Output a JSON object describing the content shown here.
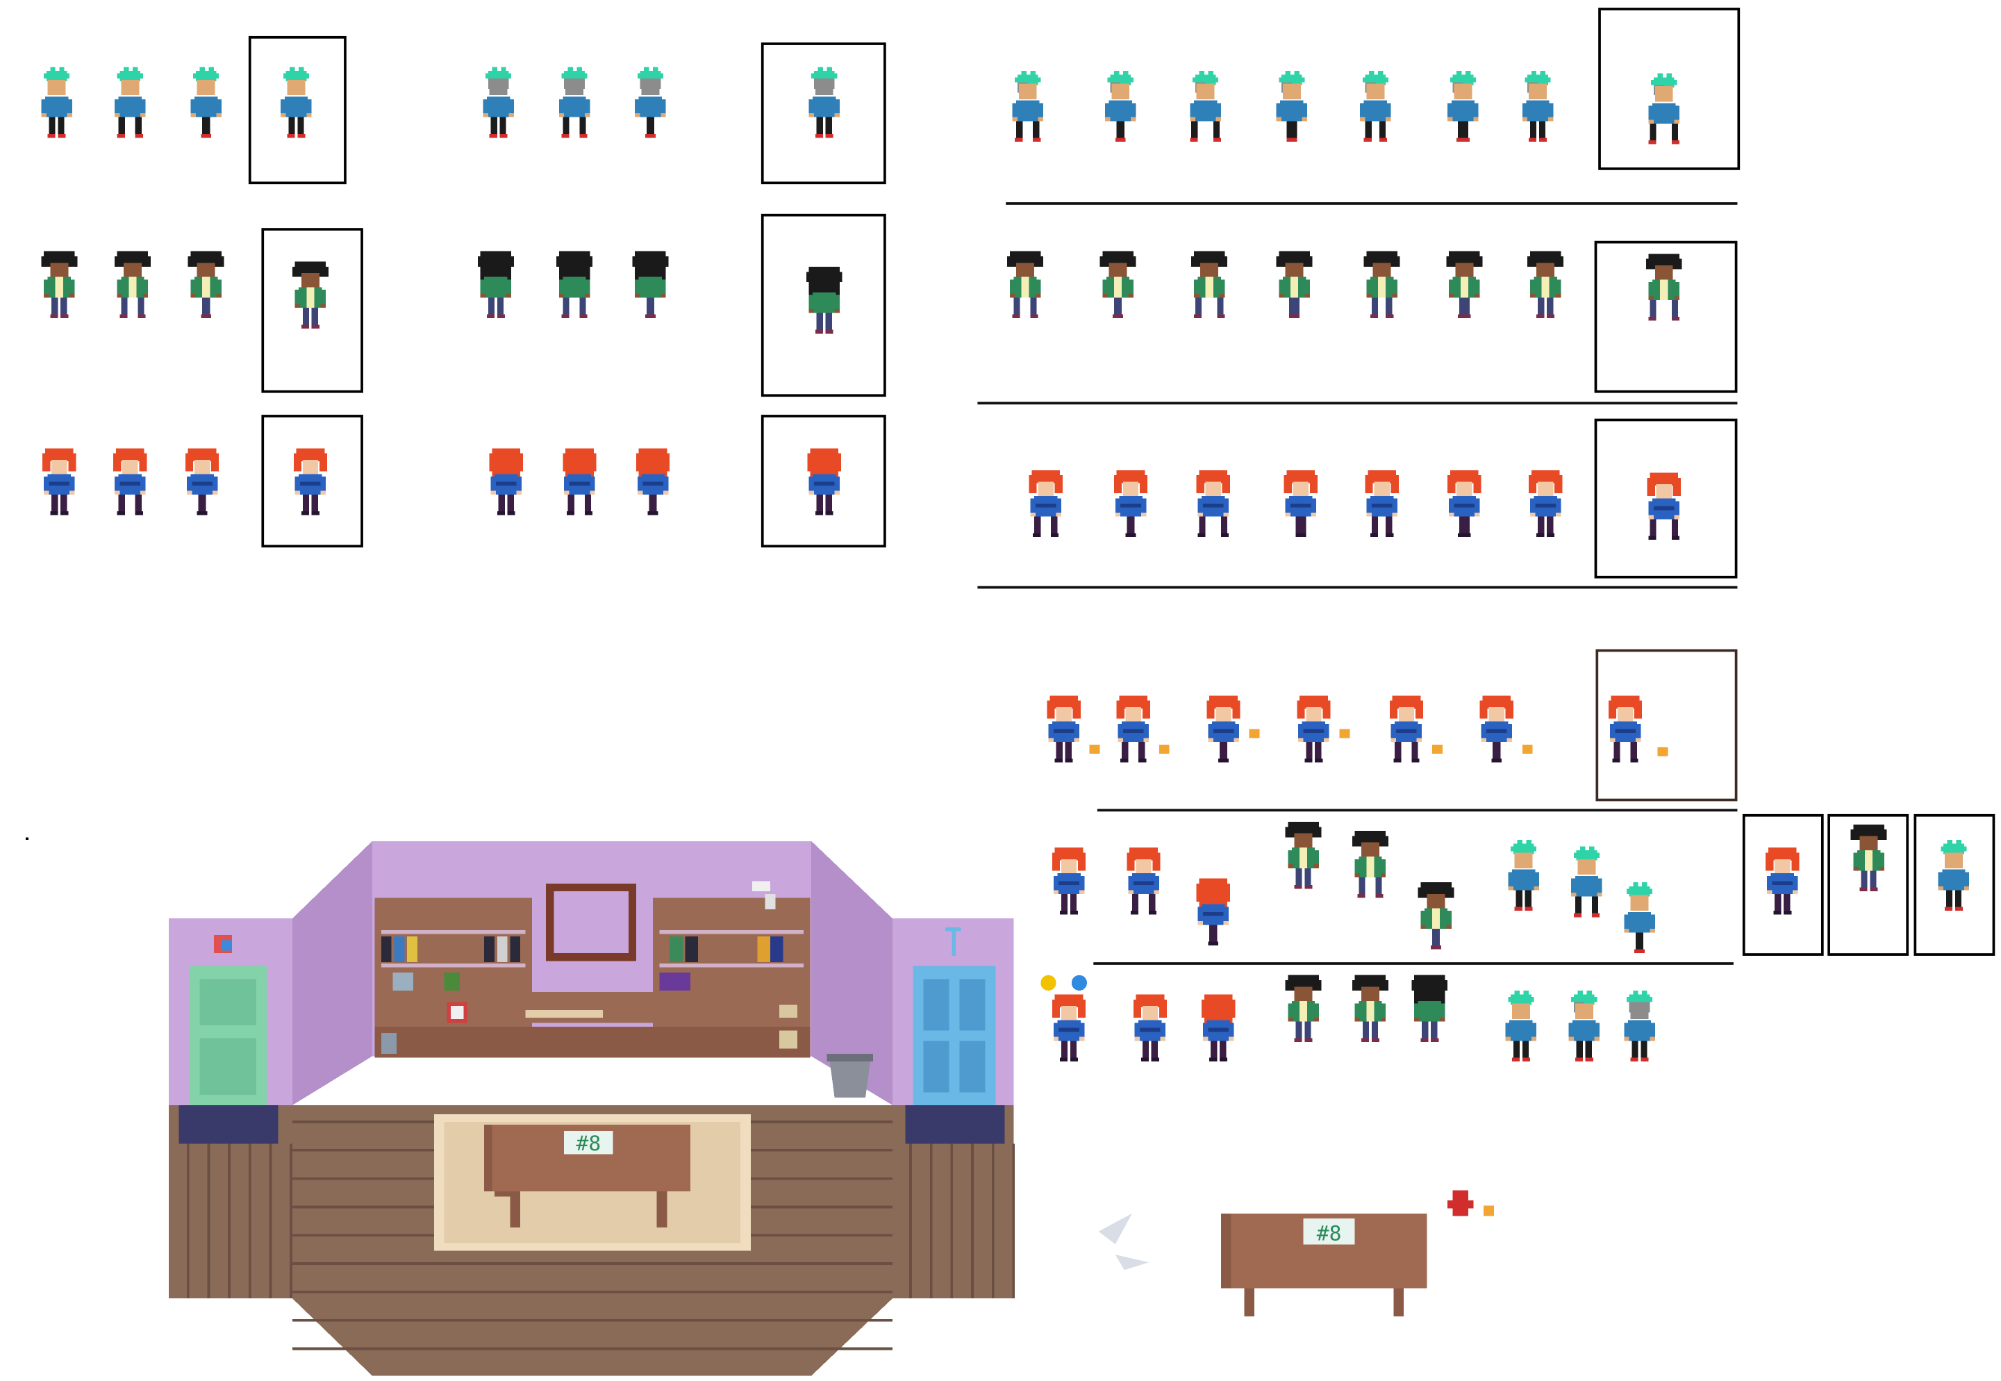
{
  "sheet": {
    "characters": [
      {
        "id": "teal-boy",
        "hair": "#2fd3a8",
        "hair_side": "#8c8c8c",
        "skin": "#e0a872",
        "shirt": "#2f7fb8",
        "sleeve": "#e56a3a",
        "pants": "#1c1c1c",
        "shoes": "#d12d2d"
      },
      {
        "id": "curly-girl",
        "hair": "#1a1a1a",
        "hair_side": "#1a1a1a",
        "skin": "#8a5436",
        "shirt": "#2f8a5a",
        "undershirt": "#f3efb6",
        "pants": "#3d4577",
        "shoes": "#7a2d4a"
      },
      {
        "id": "red-girl",
        "hair": "#e84a25",
        "hair_side": "#e84a25",
        "skin": "#f2c7a3",
        "shirt": "#2a62c2",
        "stripe": "#1c3e8a",
        "pants": "#3a1e44",
        "shoes": "#241430"
      }
    ],
    "room": {
      "wall": "#c9a6dc",
      "wall_dark": "#b48fca",
      "floor": "#8a6b58",
      "floor_line": "#6a4f42",
      "rug": "#e3ccaa",
      "rug_edge": "#f0ddc0",
      "table": "#a06a52",
      "table_top": "#8a5a46",
      "shelf": "#9a6a55",
      "door_left": "#84d2aa",
      "door_right": "#6ab8e6",
      "skirting": "#3a3a6a"
    },
    "props": {
      "sign_text": "#8",
      "paper_plane_color": "#d8dde6",
      "bucket_color": "#8a8f9a",
      "fire_hydrant_color": "#d12d2d",
      "dot_yellow": "#f2c200",
      "dot_blue": "#2f8ae0"
    }
  }
}
